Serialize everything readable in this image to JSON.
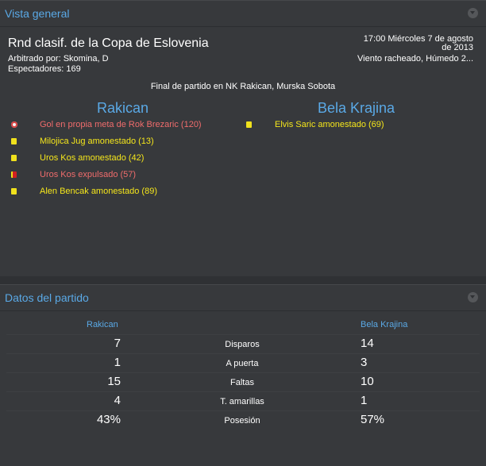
{
  "overview": {
    "title": "Vista general",
    "competition": "Rnd clasif. de la Copa de Eslovenia",
    "referee": "Arbitrado por: Skomina, D",
    "spectators": "Espectadores: 169",
    "date_line1": "17:00 Miércoles 7 de agosto",
    "date_line2": "de 2013",
    "weather": "Viento racheado, Húmedo 2...",
    "venue": "Final de partido en NK Rakican, Murska Sobota",
    "home_team": "Rakican",
    "away_team": "Bela Krajina",
    "home_events": [
      {
        "icon": "own-goal-ball-icon",
        "text": "Gol en propia meta de Rok Brezaric (120)",
        "color": "#f06c6c"
      },
      {
        "icon": "yellow-card-icon",
        "text": "Milojica Jug amonestado (13)",
        "color": "#f5e61b"
      },
      {
        "icon": "yellow-card-icon",
        "text": "Uros Kos amonestado (42)",
        "color": "#f5e61b"
      },
      {
        "icon": "red-card-icon",
        "text": "Uros Kos expulsado (57)",
        "color": "#f06c6c"
      },
      {
        "icon": "yellow-card-icon",
        "text": "Alen Bencak amonestado (89)",
        "color": "#f5e61b"
      }
    ],
    "away_events": [
      {
        "icon": "yellow-card-icon",
        "text": "Elvis Saric amonestado (69)",
        "color": "#f5e61b"
      }
    ]
  },
  "stats": {
    "title": "Datos del partido",
    "home_team": "Rakican",
    "away_team": "Bela Krajina",
    "rows": [
      {
        "label": "Disparos",
        "home": "7",
        "away": "14"
      },
      {
        "label": "A puerta",
        "home": "1",
        "away": "3"
      },
      {
        "label": "Faltas",
        "home": "15",
        "away": "10"
      },
      {
        "label": "T. amarillas",
        "home": "4",
        "away": "1"
      },
      {
        "label": "Posesión",
        "home": "43%",
        "away": "57%"
      }
    ]
  },
  "colors": {
    "accent": "#5aa9e6",
    "yellow": "#f5e61b",
    "red": "#f06c6c",
    "panel": "#37393c"
  }
}
